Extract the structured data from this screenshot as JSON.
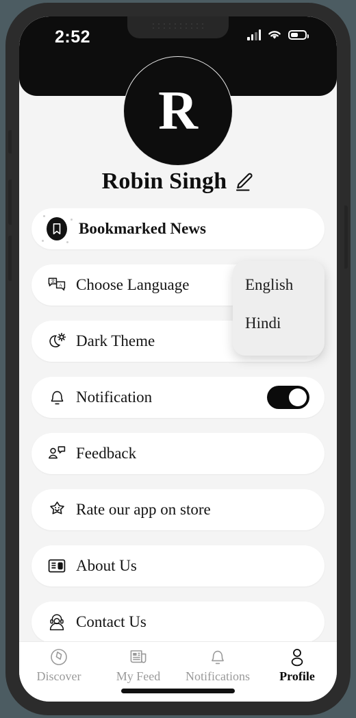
{
  "status_bar": {
    "time": "2:52",
    "signal_icon": "cellular-signal-icon",
    "wifi_icon": "wifi-icon",
    "battery_icon": "battery-icon"
  },
  "profile": {
    "avatar_initial": "R",
    "name": "Robin Singh",
    "edit_icon": "edit-pencil-icon"
  },
  "menu": {
    "items": [
      {
        "id": "bookmarked-news",
        "label": "Bookmarked News",
        "icon": "bookmark-icon",
        "bold": true,
        "control": "none"
      },
      {
        "id": "choose-language",
        "label": "Choose Language",
        "icon": "translate-icon",
        "bold": false,
        "control": "none"
      },
      {
        "id": "dark-theme",
        "label": "Dark Theme",
        "icon": "moon-sun-icon",
        "bold": false,
        "control": "toggle-off"
      },
      {
        "id": "notification",
        "label": "Notification",
        "icon": "bell-icon",
        "bold": false,
        "control": "toggle-on"
      },
      {
        "id": "feedback",
        "label": "Feedback",
        "icon": "feedback-icon",
        "bold": false,
        "control": "none"
      },
      {
        "id": "rate-app",
        "label": "Rate our app on store",
        "icon": "star-smile-icon",
        "bold": false,
        "control": "none"
      },
      {
        "id": "about-us",
        "label": "About Us",
        "icon": "article-icon",
        "bold": false,
        "control": "none"
      },
      {
        "id": "contact-us",
        "label": "Contact Us",
        "icon": "support-agent-icon",
        "bold": false,
        "control": "none"
      }
    ]
  },
  "language_dropdown": {
    "open": true,
    "options": [
      "English",
      "Hindi"
    ]
  },
  "tabbar": {
    "tabs": [
      {
        "id": "discover",
        "label": "Discover",
        "icon": "compass-icon",
        "active": false
      },
      {
        "id": "my-feed",
        "label": "My Feed",
        "icon": "newspaper-icon",
        "active": false
      },
      {
        "id": "notifications",
        "label": "Notifications",
        "icon": "bell-icon",
        "active": false
      },
      {
        "id": "profile",
        "label": "Profile",
        "icon": "person-icon",
        "active": true
      }
    ]
  },
  "colors": {
    "accent": "#0b0b0b",
    "app_background": "#f4f4f4",
    "card": "#ffffff",
    "dropdown": "#eeeeee",
    "muted_text": "#9a9a9a",
    "frame": "#2c2c2c",
    "canvas": "#4c5c62"
  }
}
